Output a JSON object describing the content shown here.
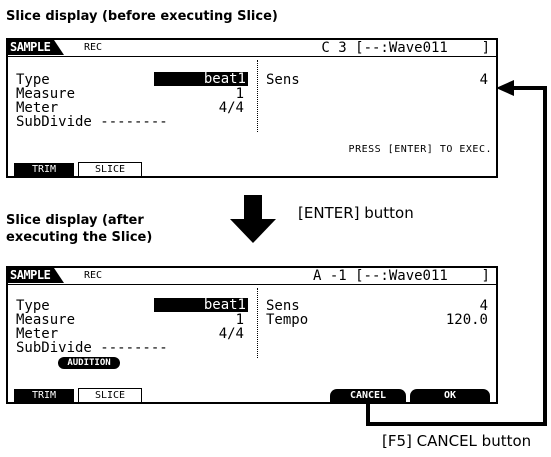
{
  "captions": {
    "before": "Slice display (before executing Slice)",
    "after_line1": "Slice display (after",
    "after_line2": "executing the Slice)",
    "enter": "[ENTER] button",
    "cancel": "[F5] CANCEL button"
  },
  "screen_before": {
    "tab_label": "SAMPLE",
    "mode": "REC",
    "wave": "C 3 [--:Wave011    ]",
    "type_label": "Type",
    "type_value": "beat1",
    "measure_label": "Measure",
    "measure_value": "1",
    "meter_label": "Meter",
    "meter_value": "4/4",
    "subdivide_label": "SubDivide --------",
    "sens_label": "Sens",
    "sens_value": "4",
    "press_text": "PRESS [ENTER] TO EXEC.",
    "tabs": [
      "TRIM",
      "SLICE"
    ]
  },
  "screen_after": {
    "tab_label": "SAMPLE",
    "mode": "REC",
    "wave": "A -1 [--:Wave011    ]",
    "type_label": "Type",
    "type_value": "beat1",
    "measure_label": "Measure",
    "measure_value": "1",
    "meter_label": "Meter",
    "meter_value": "4/4",
    "subdivide_label": "SubDivide --------",
    "audition_label": "AUDITION",
    "sens_label": "Sens",
    "sens_value": "4",
    "tempo_label": "Tempo",
    "tempo_value": "120.0",
    "tabs": [
      "TRIM",
      "SLICE"
    ],
    "cancel_label": "CANCEL",
    "ok_label": "OK"
  }
}
